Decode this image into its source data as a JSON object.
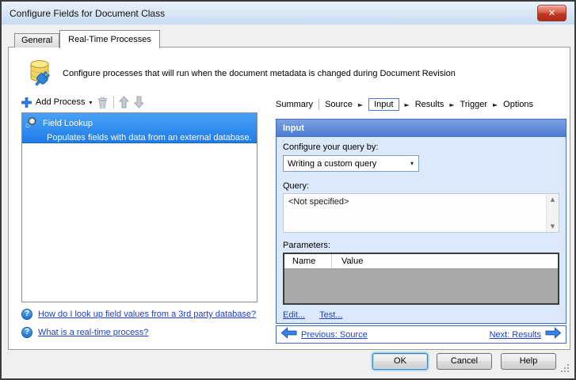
{
  "window": {
    "title": "Configure Fields for Document Class"
  },
  "icons": {
    "close": "✕",
    "dropdown": "▾",
    "breadcrumb_arrow": "►",
    "scroll_up": "▲",
    "scroll_down": "▼",
    "help_glyph": "?"
  },
  "tabs": [
    {
      "label": "General",
      "active": false
    },
    {
      "label": "Real-Time Processes",
      "active": true
    }
  ],
  "intro": {
    "text": "Configure processes that will run when the document metadata is changed during Document Revision"
  },
  "toolbar": {
    "add_label": "Add Process"
  },
  "process_list": [
    {
      "title": "Field Lookup",
      "description": "Populates fields with data from an external database.",
      "selected": true
    }
  ],
  "help_links": [
    {
      "label": "How do I look up field values from a 3rd party database?"
    },
    {
      "label": "What is a real-time process?"
    }
  ],
  "breadcrumb": {
    "summary": "Summary",
    "steps": [
      "Source",
      "Input",
      "Results",
      "Trigger",
      "Options"
    ],
    "active_step": "Input"
  },
  "panel": {
    "header": "Input",
    "query_by_label": "Configure your query by:",
    "query_by_value": "Writing a custom query",
    "query_label": "Query:",
    "query_value": "<Not specified>",
    "parameters_label": "Parameters:",
    "table": {
      "columns": [
        "Name",
        "Value"
      ],
      "rows": []
    },
    "edit_link": "Edit...",
    "test_link": "Test..."
  },
  "nav": {
    "previous": "Previous: Source",
    "next": "Next: Results"
  },
  "footer_buttons": [
    {
      "label": "OK",
      "default": true
    },
    {
      "label": "Cancel",
      "default": false
    },
    {
      "label": "Help",
      "default": false
    }
  ],
  "colors": {
    "selection_blue": "#2e86ee",
    "panel_border": "#3e6cc0",
    "panel_header_blue": "#5b86d7",
    "link_blue": "#1c3fd0",
    "close_red": "#c0392b",
    "panel_content_bg": "#dce9fb"
  }
}
